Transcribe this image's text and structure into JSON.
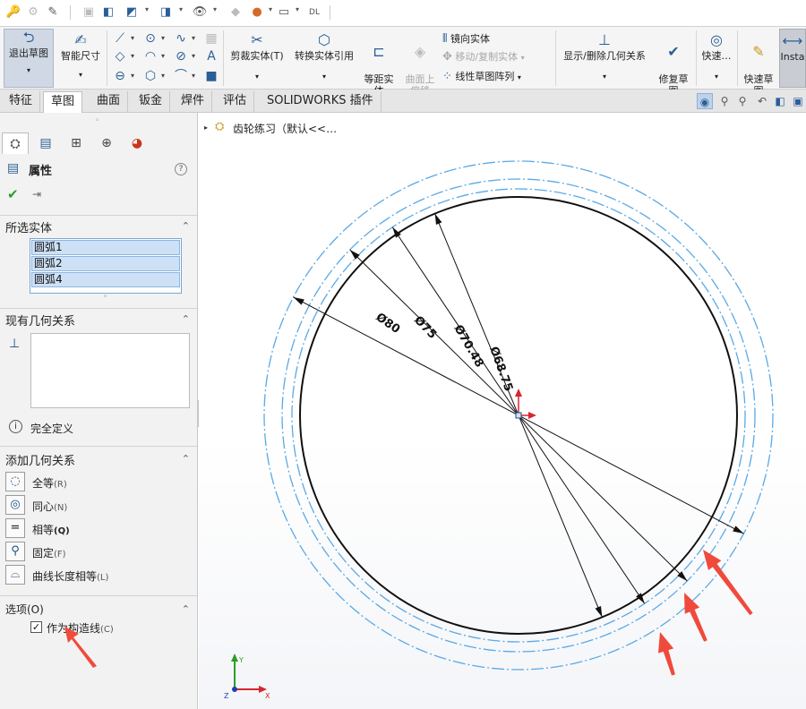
{
  "ribbon": {
    "exit_sketch": "退出草图",
    "smart_dimension": "智能尺寸",
    "trim_entities": "剪裁实体(T)",
    "convert_entities": "转换实体引用",
    "offset_entities": "等距实\n体",
    "offset_surface": "曲面上\n偏移",
    "mirror_entities": "镜向实体",
    "move_copy_entities": "移动/复制实体",
    "linear_pattern": "线性草图阵列",
    "display_delete_relations": "显示/删除几何关系",
    "repair_sketch": "修复草\n图",
    "quick_snaps": "快速…",
    "rapid_sketch": "快速草\n图",
    "instant2d": "Insta"
  },
  "tabs": [
    "特征",
    "草图",
    "曲面",
    "钣金",
    "焊件",
    "评估",
    "SOLIDWORKS 插件"
  ],
  "active_tab": "草图",
  "tree": {
    "part_name": "齿轮练习（默认<<…"
  },
  "property_manager": {
    "title": "属性",
    "help": "?",
    "selected_entities": {
      "title": "所选实体",
      "items": [
        "圆弧1",
        "圆弧2",
        "圆弧4"
      ]
    },
    "existing_relations": {
      "title": "现有几何关系",
      "status": "完全定义"
    },
    "add_relations": {
      "title": "添加几何关系",
      "items": [
        {
          "label": "全等",
          "key": "(R)",
          "icon": "coradial-icon"
        },
        {
          "label": "同心",
          "key": "(N)",
          "icon": "concentric-icon"
        },
        {
          "label": "相等",
          "key": "(Q)",
          "icon": "equal-icon"
        },
        {
          "label": "固定",
          "key": "(F)",
          "icon": "fix-icon"
        },
        {
          "label": "曲线长度相等",
          "key": "(L)",
          "icon": "equal-curve-length-icon"
        }
      ]
    },
    "options": {
      "title": "选项(O)",
      "construction_label": "作为构造线",
      "construction_key": "(C)",
      "construction_checked": true
    }
  },
  "drawing": {
    "dimensions": [
      "Ø80",
      "Ø75",
      "Ø70.48",
      "Ø68.75"
    ],
    "colors": {
      "construction": "#5aa9e6",
      "solid": "#111111",
      "arrow_annotation": "#f04a3c",
      "origin": "#d6262f"
    }
  },
  "triad": {
    "x": "X",
    "y": "Y",
    "z": "Z"
  }
}
